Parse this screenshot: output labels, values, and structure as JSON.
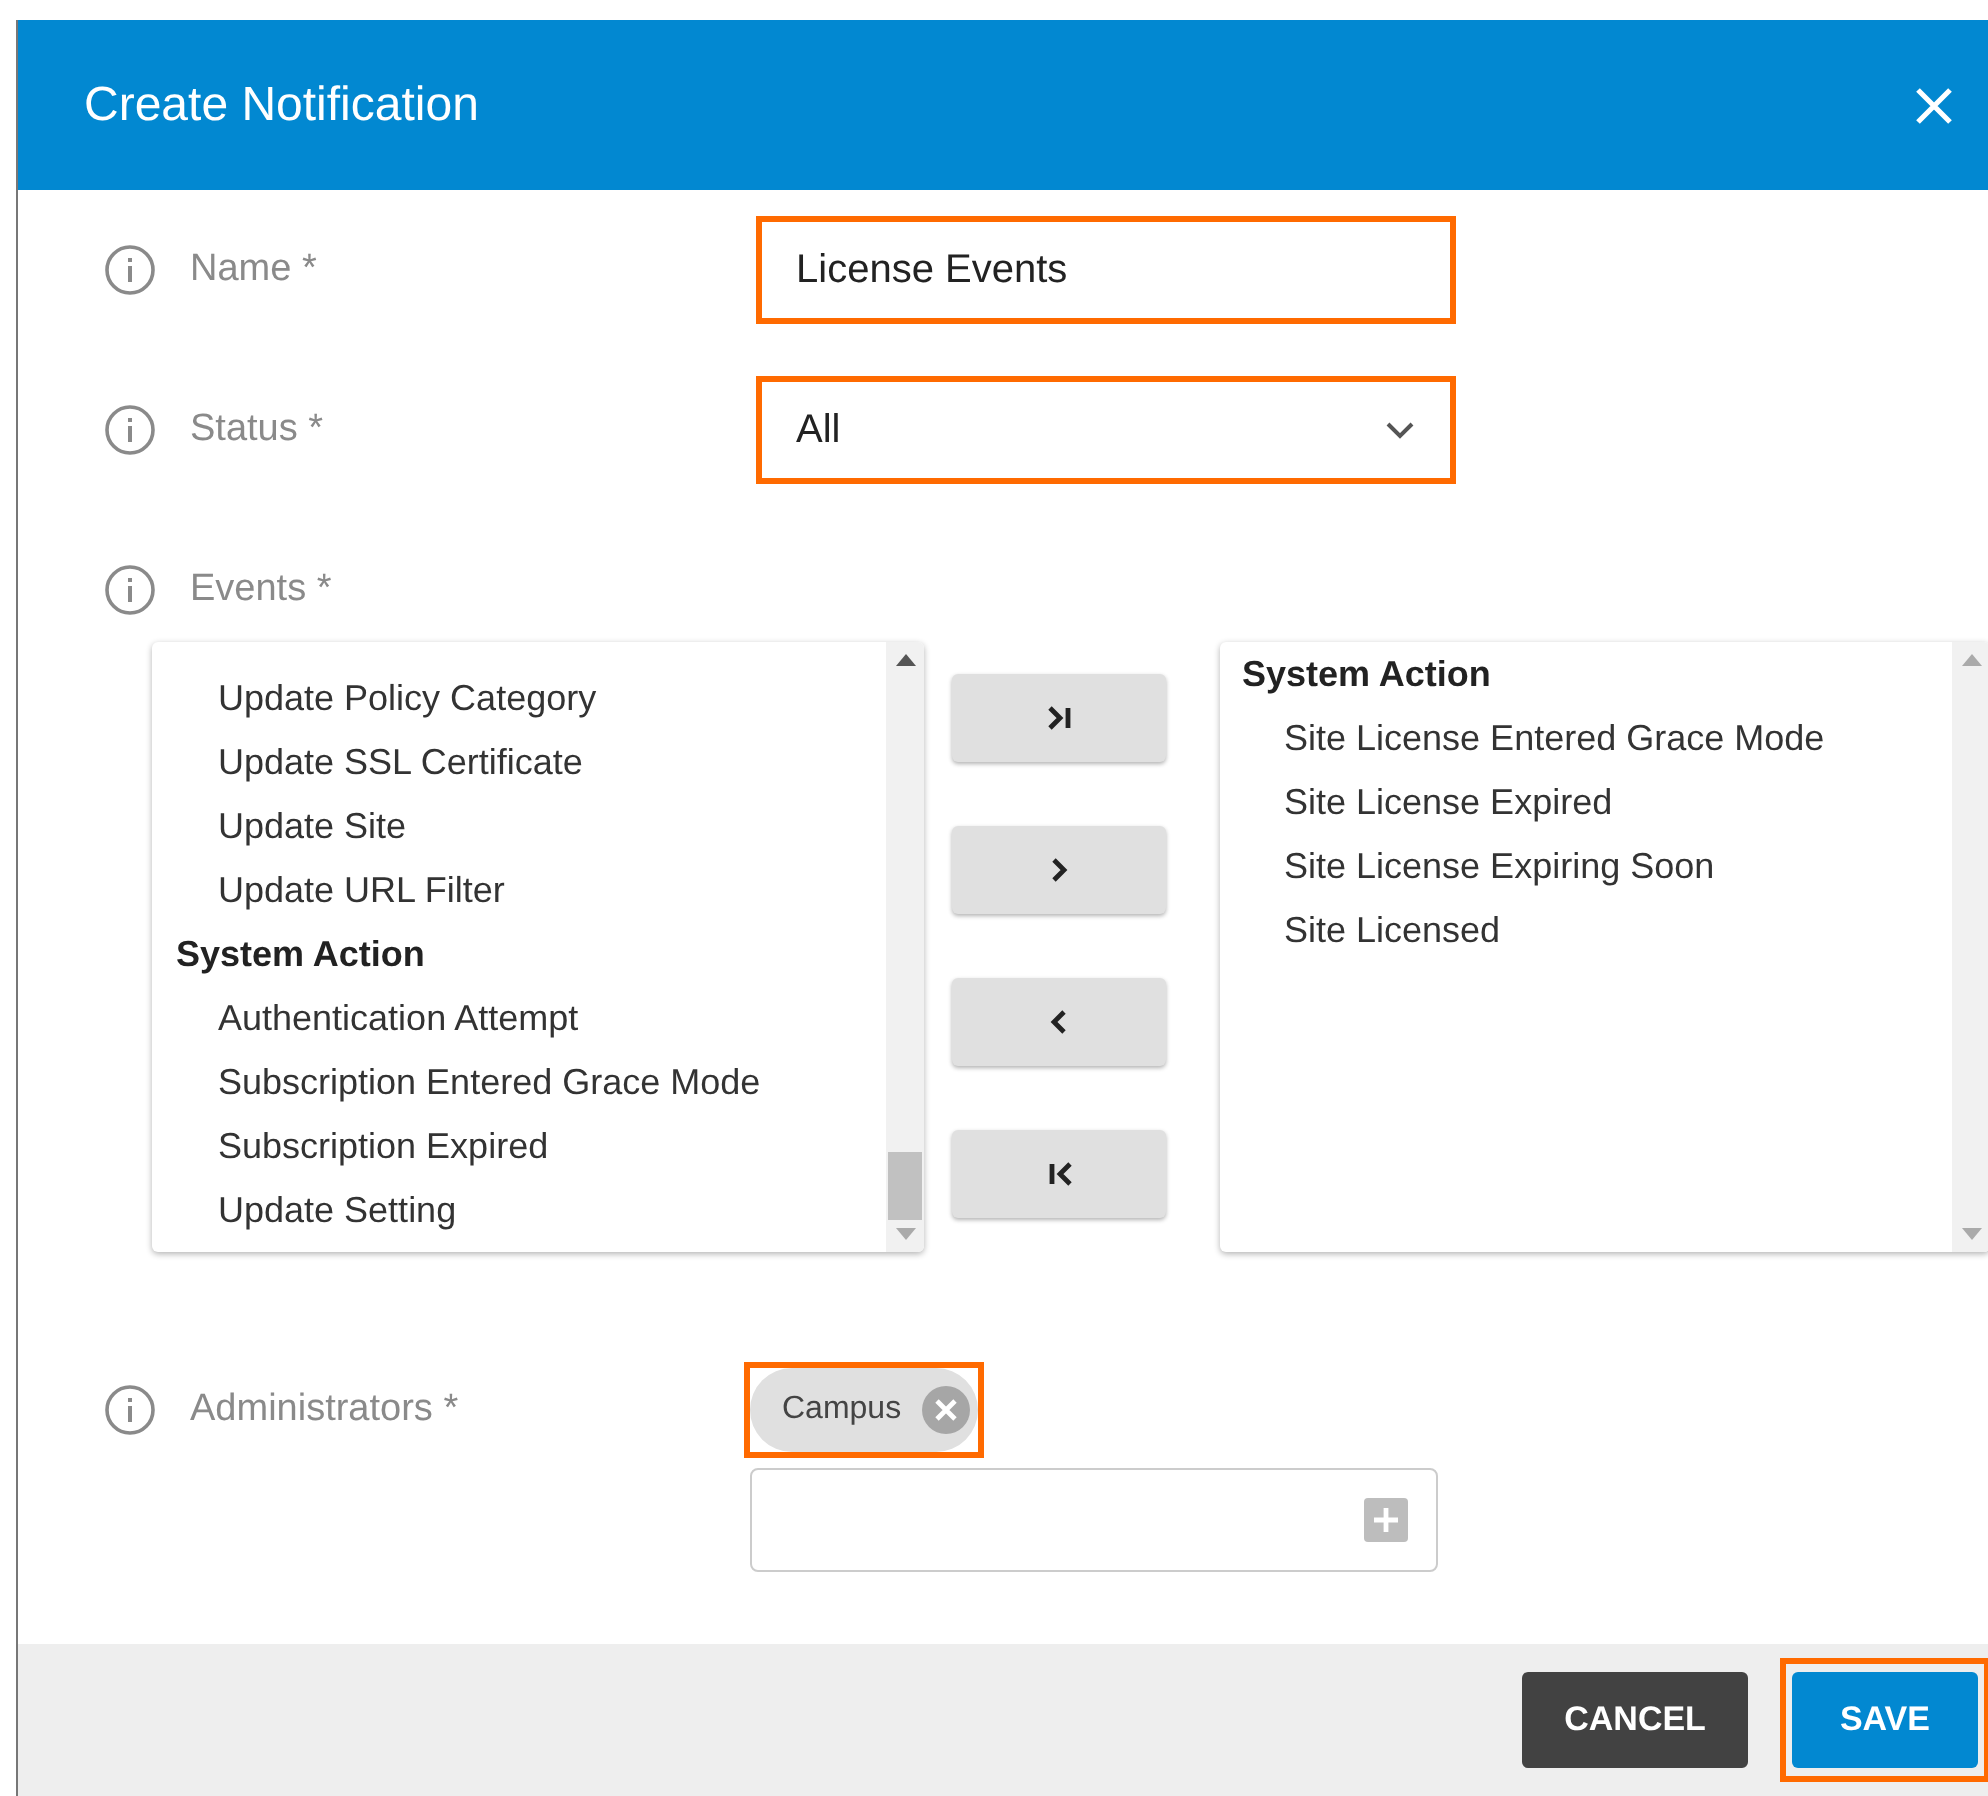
{
  "dialog": {
    "title": "Create Notification"
  },
  "fields": [
    {
      "kind": "text",
      "label": "Name *",
      "value": "License Events",
      "highlighted": true
    },
    {
      "kind": "select",
      "label": "Status *",
      "value": "All",
      "highlighted": true
    }
  ],
  "events": {
    "label": "Events *",
    "available": [
      {
        "kind": "item",
        "text": "Update Policy Category"
      },
      {
        "kind": "item",
        "text": "Update SSL Certificate"
      },
      {
        "kind": "item",
        "text": "Update Site"
      },
      {
        "kind": "item",
        "text": "Update URL Filter"
      },
      {
        "kind": "group",
        "text": "System Action"
      },
      {
        "kind": "item",
        "text": "Authentication Attempt"
      },
      {
        "kind": "item",
        "text": "Subscription Entered Grace Mode"
      },
      {
        "kind": "item",
        "text": "Subscription Expired"
      },
      {
        "kind": "item",
        "text": "Update Setting"
      }
    ],
    "move_buttons": [
      {
        "kind": "all-right"
      },
      {
        "kind": "right"
      },
      {
        "kind": "left"
      },
      {
        "kind": "all-left"
      }
    ],
    "chosen": [
      {
        "kind": "group",
        "text": "System Action"
      },
      {
        "kind": "item",
        "text": "Site License Entered Grace Mode"
      },
      {
        "kind": "item",
        "text": "Site License Expired"
      },
      {
        "kind": "item",
        "text": "Site License Expiring Soon"
      },
      {
        "kind": "item",
        "text": "Site Licensed"
      }
    ]
  },
  "administrators": {
    "label": "Administrators *",
    "chips": [
      {
        "text": "Campus",
        "highlighted": true
      }
    ]
  },
  "footer_buttons": [
    {
      "kind": "secondary",
      "label": "CANCEL",
      "highlighted": false
    },
    {
      "kind": "primary",
      "label": "SAVE",
      "highlighted": true
    }
  ]
}
